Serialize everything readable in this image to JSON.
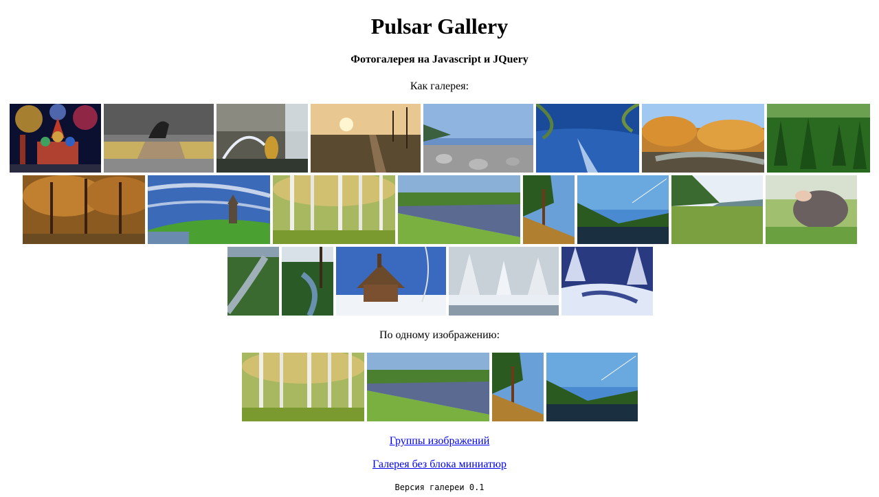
{
  "header": {
    "title": "Pulsar Gallery",
    "subtitle": "Фотогалерея на Javascript и JQuery"
  },
  "gallery": {
    "label": "Как галерея:",
    "thumbnails": [
      {
        "subject": "st-basils-cathedral-fireworks"
      },
      {
        "subject": "bronze-horseman-statue"
      },
      {
        "subject": "peterhof-fountain"
      },
      {
        "subject": "railway-sunset"
      },
      {
        "subject": "rocky-lake-shore"
      },
      {
        "subject": "sparkling-water-branches"
      },
      {
        "subject": "autumn-river-forest"
      },
      {
        "subject": "green-conifer-forest"
      },
      {
        "subject": "autumn-woodland-path"
      },
      {
        "subject": "wooden-church-on-hill"
      },
      {
        "subject": "birch-grove"
      },
      {
        "subject": "calm-river-meadow"
      },
      {
        "subject": "pine-tree-slope"
      },
      {
        "subject": "river-valley-blue-sky"
      },
      {
        "subject": "green-meadow-hills"
      },
      {
        "subject": "hedgehog-in-grass"
      },
      {
        "subject": "river-canyon-aerial"
      },
      {
        "subject": "forest-river-bend"
      },
      {
        "subject": "wooden-church-winter"
      },
      {
        "subject": "snowy-trees"
      },
      {
        "subject": "frozen-winter-stream"
      }
    ]
  },
  "single": {
    "label": "По одному изображению:",
    "thumbnails": [
      {
        "subject": "birch-grove"
      },
      {
        "subject": "calm-river-meadow"
      },
      {
        "subject": "pine-tree-slope"
      },
      {
        "subject": "river-valley-blue-sky"
      }
    ]
  },
  "links": {
    "groups": "Группы изображений",
    "no_thumbnails": "Галерея без блока миниатюр"
  },
  "footer": {
    "version": "Версия галереи 0.1"
  },
  "colors": {
    "link": "#0000ee"
  }
}
